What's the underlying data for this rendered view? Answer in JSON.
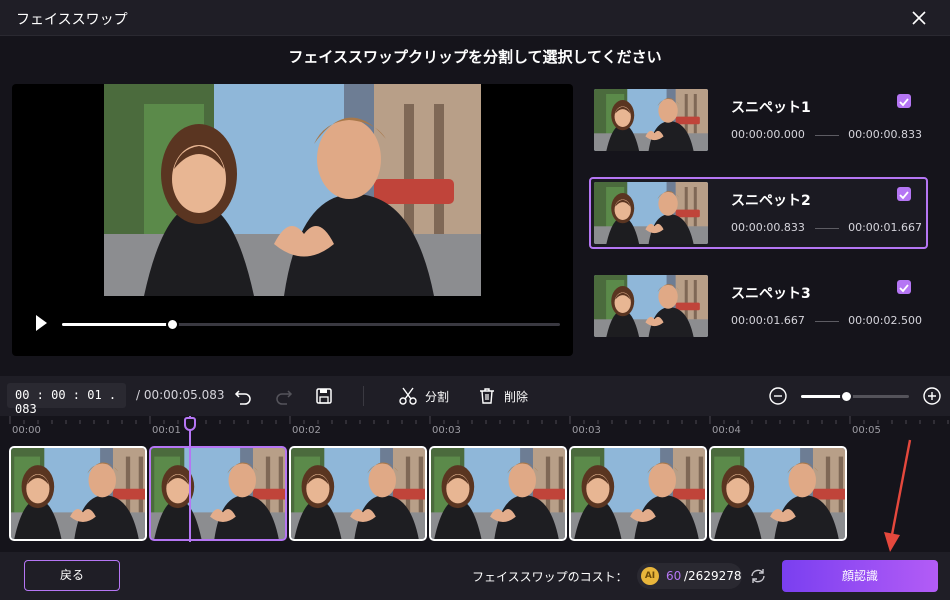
{
  "window": {
    "title": "フェイススワップ"
  },
  "heading": "フェイススワップクリップを分割して選択してください",
  "player": {
    "progress_fraction": 0.22
  },
  "snippets": [
    {
      "name": "スニペット1",
      "start": "00:00:00.000",
      "end": "00:00:00.833",
      "checked": true,
      "selected": false
    },
    {
      "name": "スニペット2",
      "start": "00:00:00.833",
      "end": "00:00:01.667",
      "checked": true,
      "selected": true
    },
    {
      "name": "スニペット3",
      "start": "00:00:01.667",
      "end": "00:00:02.500",
      "checked": true,
      "selected": false
    }
  ],
  "toolbar": {
    "current_time": "00 : 00 : 01 . 083",
    "total_time": "/ 00:00:05.083",
    "split_label": "分割",
    "delete_label": "削除",
    "zoom_fraction": 0.42
  },
  "timeline": {
    "ticks": [
      "00:00",
      "00:01",
      "00:02",
      "00:03",
      "00:03",
      "00:04",
      "00:05"
    ],
    "frame_count": 6,
    "active_frame": 1
  },
  "footer": {
    "back_label": "戻る",
    "cost_label": "フェイススワップのコスト：",
    "coin_label": "AI",
    "cost_used": "60",
    "cost_total": "/2629278",
    "primary_label": "顔認識"
  },
  "colors": {
    "accent": "#b576f4",
    "background": "#15141b",
    "panel": "#1f1e26"
  },
  "icons": [
    "close-icon",
    "play-icon",
    "undo-icon",
    "redo-icon",
    "save-icon",
    "scissors-icon",
    "trash-icon",
    "zoom-out-icon",
    "zoom-in-icon",
    "refresh-icon",
    "check-icon",
    "red-arrow"
  ]
}
